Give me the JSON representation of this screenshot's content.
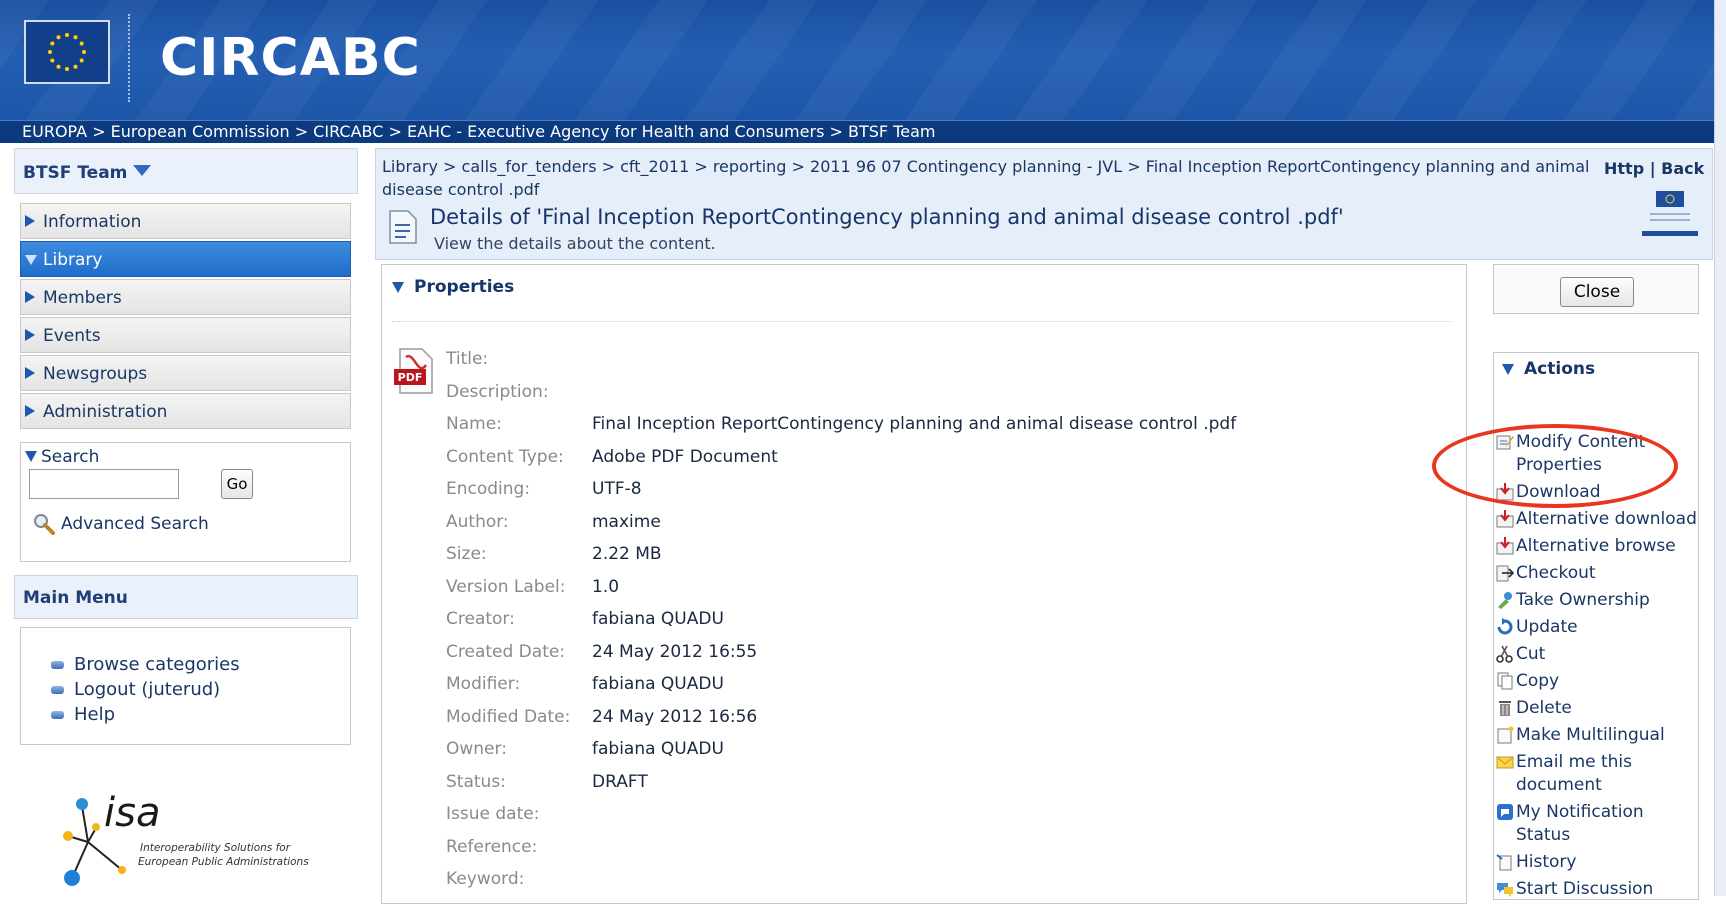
{
  "header": {
    "app_title": "CIRCABC",
    "breadcrumb": "EUROPA  > European Commission  > CIRCABC  > EAHC - Executive Agency for Health and Consumers > BTSF Team"
  },
  "left": {
    "group_title": "BTSF Team",
    "nav": [
      {
        "label": "Information",
        "active": false
      },
      {
        "label": "Library",
        "active": true
      },
      {
        "label": "Members",
        "active": false
      },
      {
        "label": "Events",
        "active": false
      },
      {
        "label": "Newsgroups",
        "active": false
      },
      {
        "label": "Administration",
        "active": false
      }
    ],
    "search": {
      "title": "Search",
      "input_value": "",
      "go_label": "Go",
      "advanced_label": "Advanced Search"
    },
    "main_menu": {
      "title": "Main Menu",
      "items": [
        "Browse categories",
        "Logout (juterud)",
        "Help"
      ]
    },
    "logo": {
      "name": "isa",
      "tagline_1": "Interoperability Solutions for",
      "tagline_2": "European Public Administrations"
    }
  },
  "content": {
    "path": "Library > calls_for_tenders > cft_2011 > reporting > 2011 96 07 Contingency planning - JVL > Final Inception ReportContingency planning and animal disease control .pdf",
    "http_back": "Http  |  Back",
    "details_title": "Details of 'Final Inception ReportContingency planning and animal disease control .pdf'",
    "details_sub": "View the details about the content.",
    "properties_title": "Properties",
    "properties": [
      {
        "k": "Title:",
        "v": ""
      },
      {
        "k": "Description:",
        "v": ""
      },
      {
        "k": "Name:",
        "v": "Final Inception ReportContingency planning and animal disease control .pdf"
      },
      {
        "k": "Content Type:",
        "v": "Adobe PDF Document"
      },
      {
        "k": "Encoding:",
        "v": "UTF-8"
      },
      {
        "k": "Author:",
        "v": "maxime"
      },
      {
        "k": "Size:",
        "v": "2.22 MB"
      },
      {
        "k": "Version Label:",
        "v": "1.0"
      },
      {
        "k": "Creator:",
        "v": "fabiana QUADU"
      },
      {
        "k": "Created Date:",
        "v": "24 May 2012 16:55"
      },
      {
        "k": "Modifier:",
        "v": "fabiana QUADU"
      },
      {
        "k": "Modified Date:",
        "v": "24 May 2012 16:56"
      },
      {
        "k": "Owner:",
        "v": "fabiana QUADU"
      },
      {
        "k": "Status:",
        "v": "DRAFT"
      },
      {
        "k": "Issue date:",
        "v": ""
      },
      {
        "k": "Reference:",
        "v": ""
      },
      {
        "k": "Keyword:",
        "v": ""
      }
    ],
    "pdf_label": "PDF"
  },
  "right": {
    "close_label": "Close",
    "actions_title": "Actions",
    "actions": [
      {
        "label": "Modify Content Properties",
        "icon": "edit-icon"
      },
      {
        "label": "Download",
        "icon": "download-icon"
      },
      {
        "label": "Alternative download",
        "icon": "download-icon"
      },
      {
        "label": "Alternative browse",
        "icon": "download-icon"
      },
      {
        "label": "Checkout",
        "icon": "checkout-icon"
      },
      {
        "label": "Take Ownership",
        "icon": "ownership-icon"
      },
      {
        "label": "Update",
        "icon": "update-icon"
      },
      {
        "label": "Cut",
        "icon": "scissors-icon"
      },
      {
        "label": "Copy",
        "icon": "copy-icon"
      },
      {
        "label": "Delete",
        "icon": "trash-icon"
      },
      {
        "label": "Make Multilingual",
        "icon": "multilingual-icon"
      },
      {
        "label": "Email me this document",
        "icon": "email-icon"
      },
      {
        "label": "My Notification Status",
        "icon": "notification-icon"
      },
      {
        "label": "History",
        "icon": "history-icon"
      },
      {
        "label": "Start Discussion",
        "icon": "discussion-icon"
      }
    ]
  },
  "colors": {
    "header_blue": "#1d56a8",
    "breadcrumb_bg": "#0b3a7e",
    "active_nav": "#1f6dc9",
    "highlight": "#e8371e"
  }
}
